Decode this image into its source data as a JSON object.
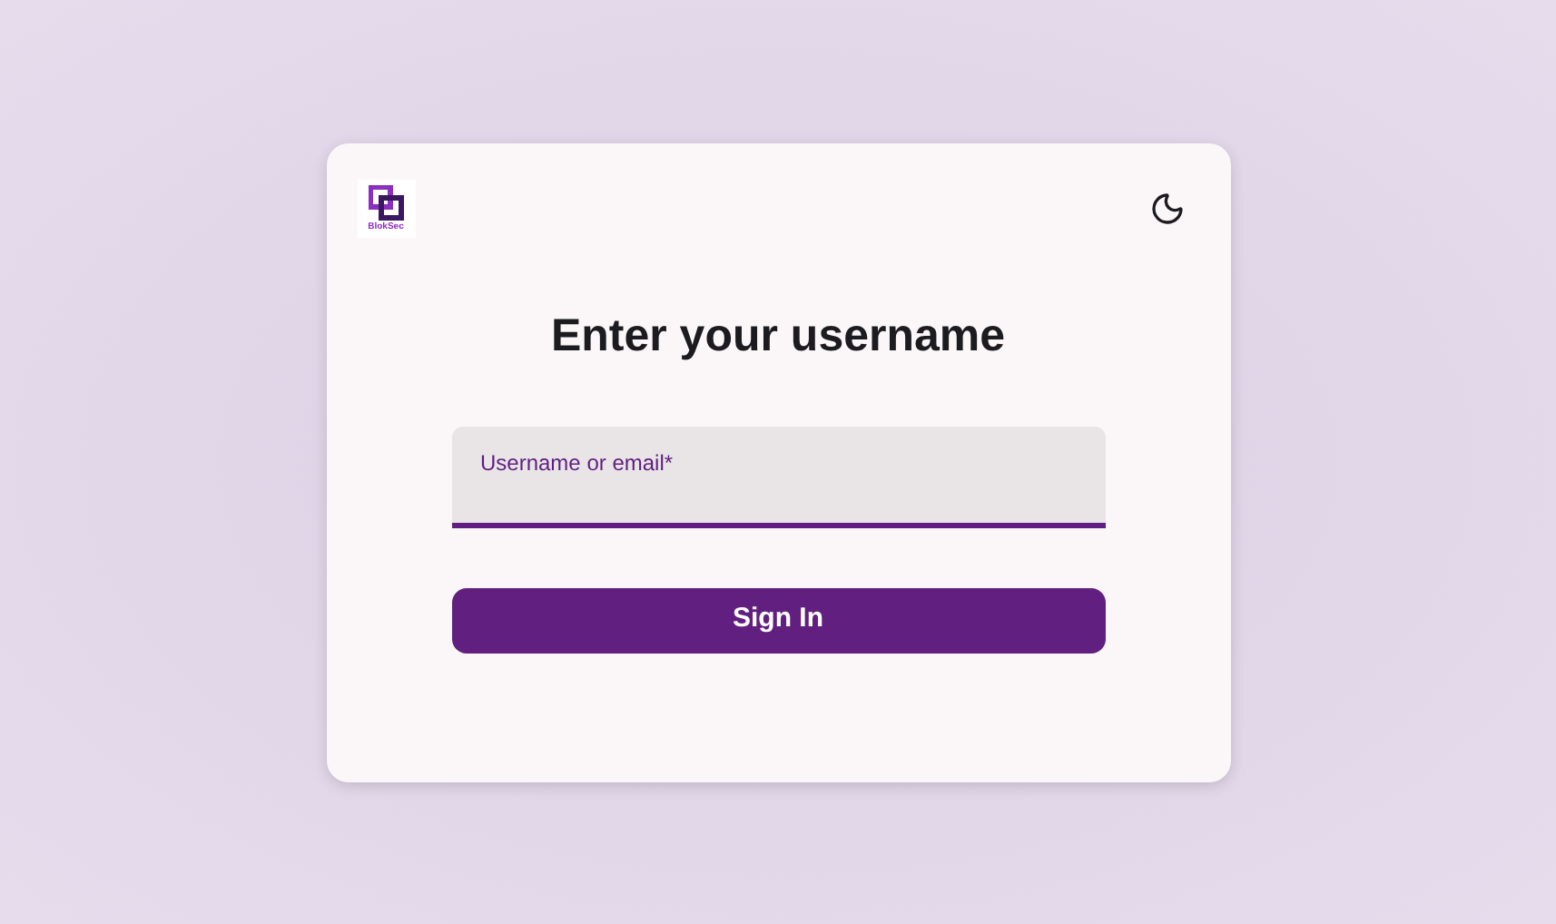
{
  "logo": {
    "text": "BlokSec"
  },
  "title": "Enter your username",
  "username_field": {
    "label": "Username or email*",
    "focused": true
  },
  "buttons": [
    {
      "label": "Sign In"
    }
  ]
}
